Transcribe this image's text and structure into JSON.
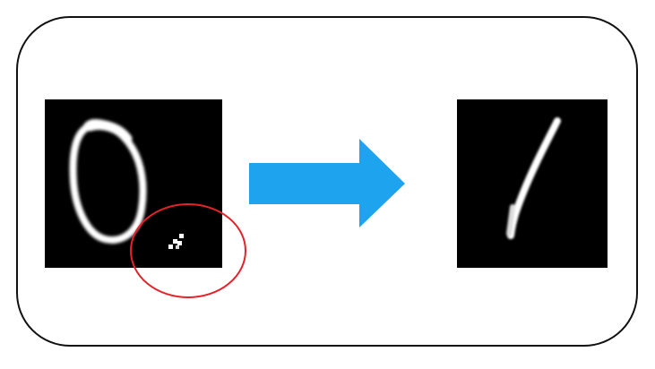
{
  "diagram": {
    "input_image": {
      "icon": "digit-zero-image",
      "digit_shown": "0",
      "perturbation": "small-adversarial-patch"
    },
    "transition": {
      "icon": "right-arrow-icon",
      "color": "#1ea3ee"
    },
    "output_image": {
      "icon": "digit-one-image",
      "digit_shown": "1"
    },
    "highlight": {
      "icon": "red-circle-highlight",
      "color": "#e5222a"
    },
    "colors": {
      "frame_border": "#111111",
      "panel_background": "#000000",
      "stroke": "#ffffff"
    }
  }
}
